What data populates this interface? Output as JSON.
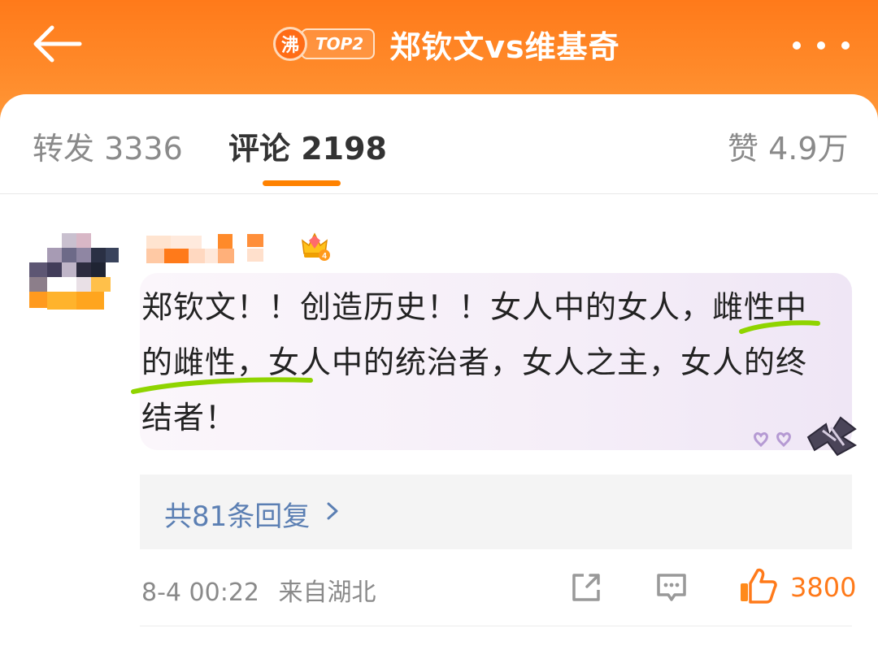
{
  "header": {
    "badge_char": "沸",
    "badge_rank": "TOP2",
    "title": "郑钦文vs维基奇"
  },
  "tabs": {
    "repost": "转发 3336",
    "comments": "评论 2198",
    "likes": "赞 4.9万"
  },
  "comment": {
    "text": "郑钦文！！创造历史！！女人中的女人，雌性中的雌性，女人中的统治者，女人之主，女人的终结者！",
    "replies_label": "共81条回复",
    "time": "8-4 00:22",
    "location": "来自湖北",
    "like_count": "3800",
    "rank_badge_number": "4"
  },
  "icons": {
    "back": "back-arrow-icon",
    "more": "more-dots-icon",
    "share": "share-icon",
    "comment": "comment-icon",
    "like": "thumbs-up-icon",
    "chevron": "chevron-right-icon"
  },
  "colors": {
    "header_orange": "#ff7a1a",
    "accent": "#ff8200",
    "link_blue": "#5b7fb3",
    "highlight_green": "#8fd400"
  }
}
